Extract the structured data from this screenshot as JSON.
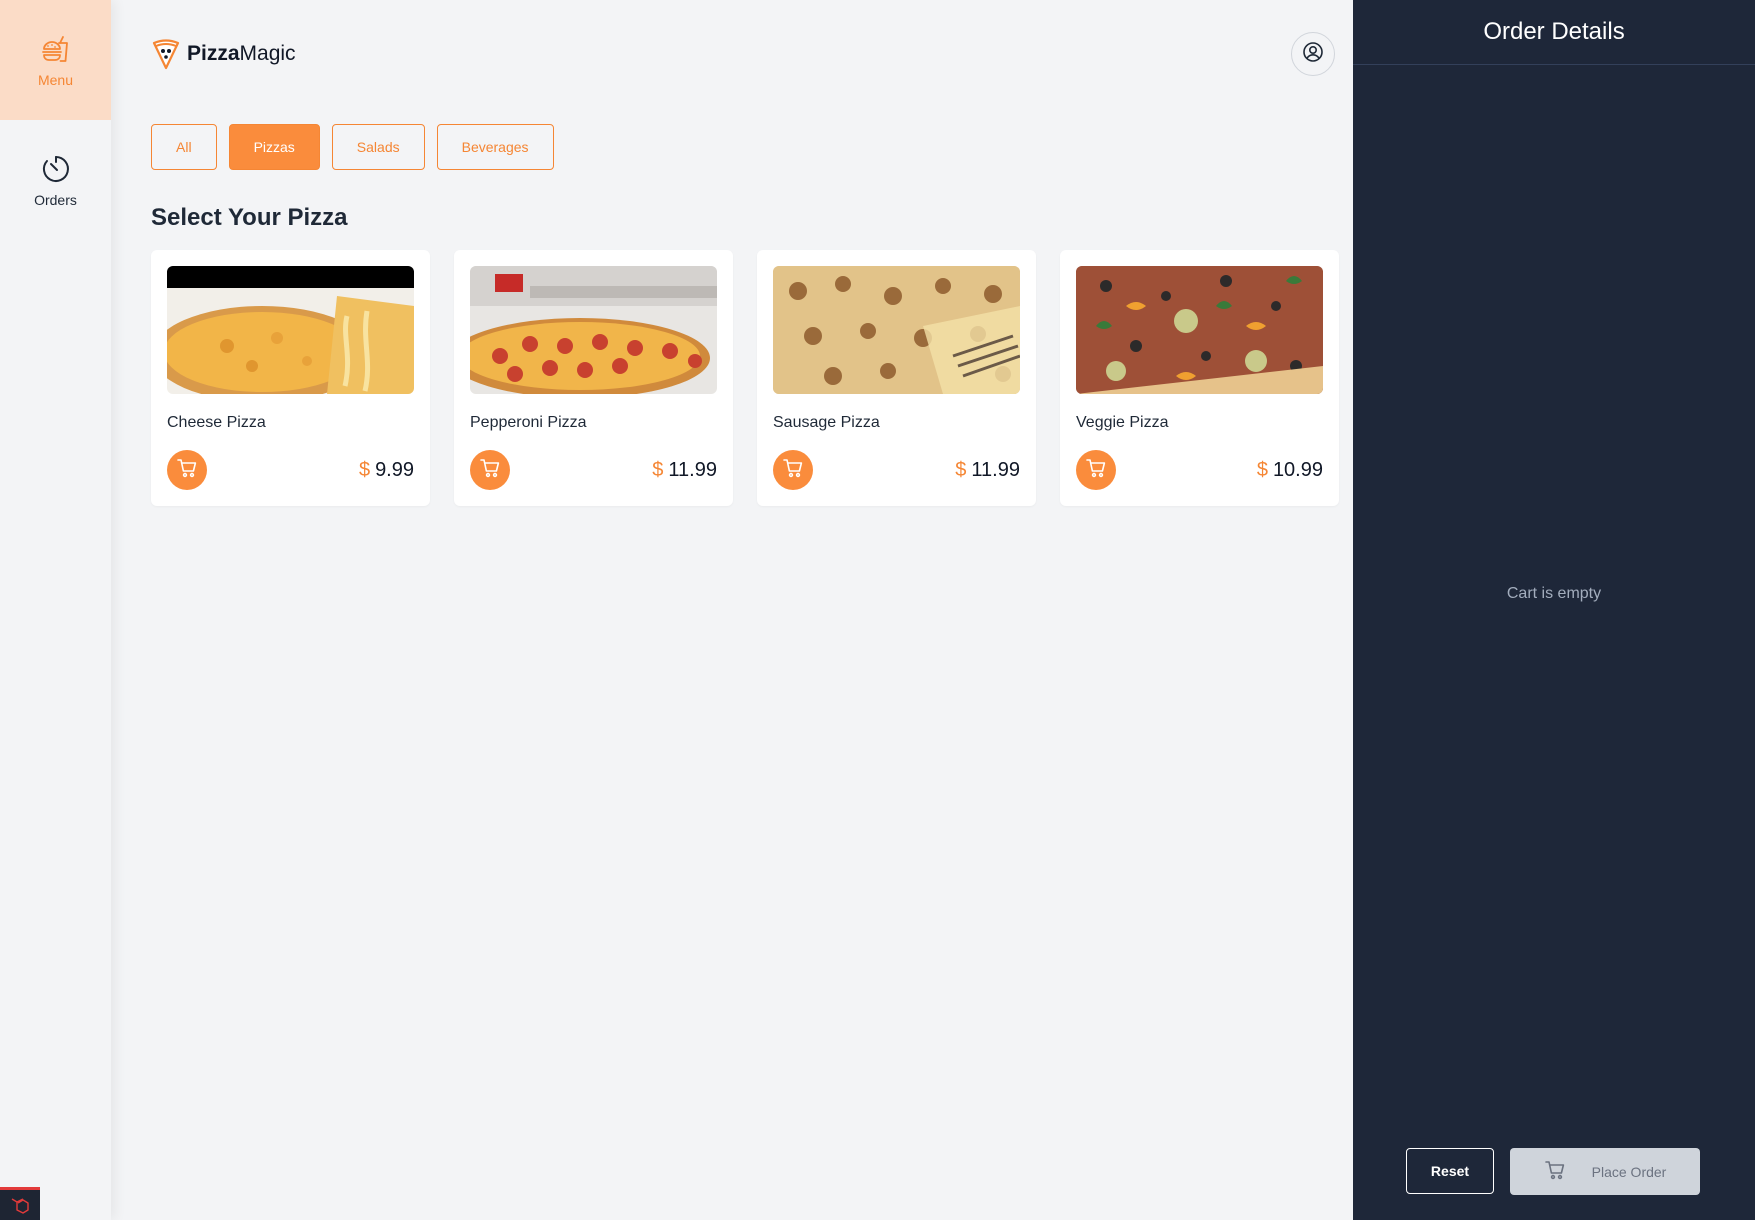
{
  "sidebar": {
    "items": [
      {
        "label": "Menu",
        "icon": "fast-food-icon",
        "active": true
      },
      {
        "label": "Orders",
        "icon": "timer-icon",
        "active": false
      }
    ]
  },
  "header": {
    "brand_bold": "Pizza",
    "brand_rest": "Magic",
    "user_icon": "user-circle-icon"
  },
  "filters": [
    {
      "label": "All",
      "active": false
    },
    {
      "label": "Pizzas",
      "active": true
    },
    {
      "label": "Salads",
      "active": false
    },
    {
      "label": "Beverages",
      "active": false
    }
  ],
  "section_title": "Select Your Pizza",
  "products": [
    {
      "name": "Cheese Pizza",
      "currency": "$",
      "price": "9.99"
    },
    {
      "name": "Pepperoni Pizza",
      "currency": "$",
      "price": "11.99"
    },
    {
      "name": "Sausage Pizza",
      "currency": "$",
      "price": "11.99"
    },
    {
      "name": "Veggie Pizza",
      "currency": "$",
      "price": "10.99"
    }
  ],
  "order_panel": {
    "title": "Order Details",
    "empty_text": "Cart is empty",
    "reset_label": "Reset",
    "place_order_label": "Place Order"
  },
  "colors": {
    "accent": "#fa8c3c",
    "panel_bg": "#1e2739",
    "active_nav_bg": "#fbdcc7"
  }
}
